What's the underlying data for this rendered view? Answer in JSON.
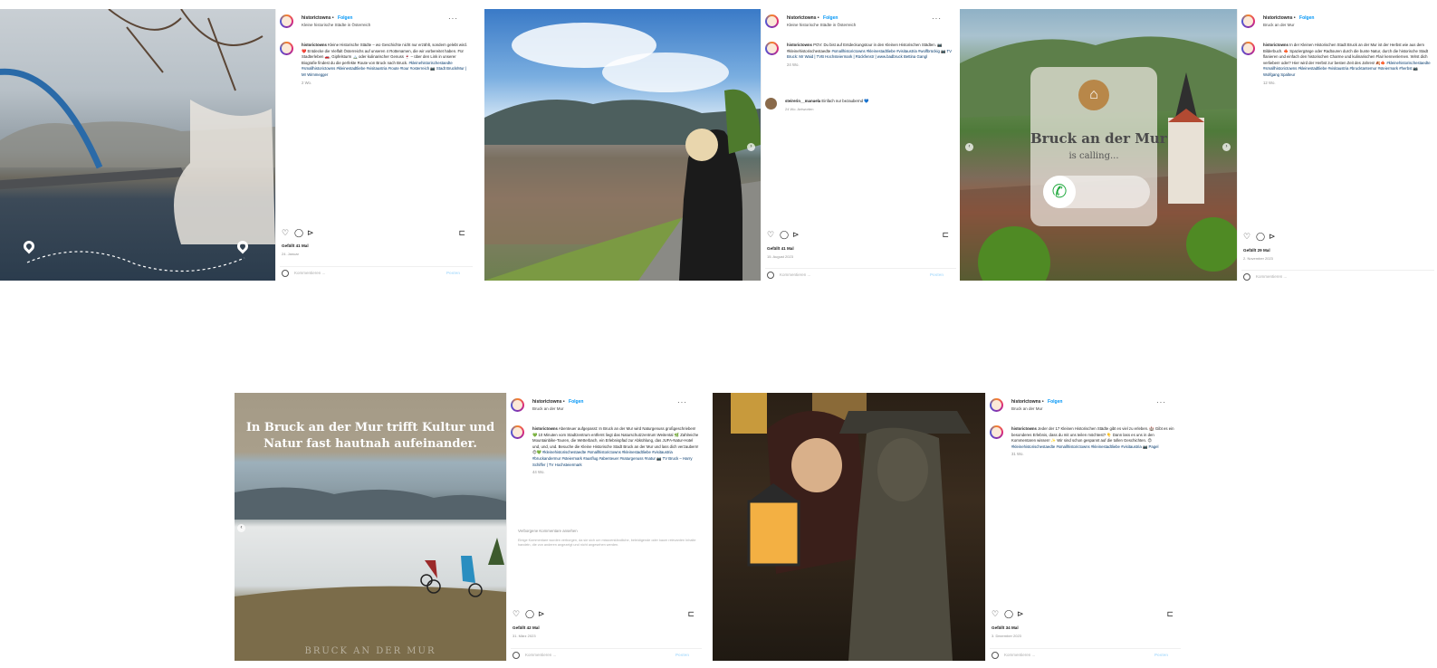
{
  "posts": [
    {
      "username": "historictowns",
      "follow_label": "Folgen",
      "subtitle": "Kleine historische Städte in Österreich",
      "more_label": "···",
      "caption_user": "historictowns",
      "caption": "Kleine Historische Städte – wo Geschichte nicht nur erzählt, sondern gelebt wird. ❤️ Entdecke die Vielfalt Österreichs auf unseren 4 Rottenamen, die wir vorbereitet haben. Für Stadterleben 🚗, Gipfelsturm 🏔️ oder kulinarischer Genuss 🍷 – über den Link in unserer Biografie findest du die perfekte Route von Bruck nach Bruck. ",
      "tags": "#kleinehistorischestaedte #smallhistorictowns #kleinestadtliebe #visitaustria #route #tour #osterreich 📷 Stadt Bruck/Mur | Mr Wimmegger",
      "time": "2 Wo.",
      "likes": "Gefällt 41 Mal",
      "date": "24. Januar",
      "comment_placeholder": "Kommentieren ...",
      "post_label": "Posten"
    },
    {
      "username": "historictowns",
      "follow_label": "Folgen",
      "subtitle": "Kleine historische Städte in Österreich",
      "more_label": "···",
      "caption_user": "historictowns",
      "caption": "POV: Du bist auf Entdeckungstour in den Kleinen Historischen Städten. 📷 #kleinehistorischestaedte ",
      "tags": "#smallhistorictowns #kleinestadtliebe #visitaustria #wolfbrückig 📷 TV Bruck: Mr Waid | TVB Hochsteiermark | Rückfenstr | www.badbruck Bettina Gangl",
      "time": "24 Wo.",
      "reply_user": "steirerin__manuela",
      "reply_text": "Einfach nur bezaubernd 💙",
      "reply_meta": "24 Wo.   Antworten",
      "likes": "Gefällt 41 Mal",
      "date": "15. August 2023",
      "comment_placeholder": "Kommentieren ...",
      "post_label": "Posten"
    },
    {
      "username": "historictowns",
      "follow_label": "Folgen",
      "subtitle": "Bruck an der Mur",
      "more_label": "···",
      "caption_user": "historictowns",
      "caption": "In der Kleinen Historischen Stadt Bruck an der Mur ist der Herbst wie aus dem Bilderbuch. 🍁 Spaziergänge oder Radtouren durch die bunte Natur, durch die historische Stadt flanieren und einfach den historischen Charme und kulinarischen Flair kennenlernen. Wirst dich verlieben! oder? Hier wird der Herbst zur besten Zeit des Jahres! 🍂🍁 ",
      "tags": "#kleinehistorischestaedte #smallhistorictowns #kleinestadtliebe #visitaustria #brucktantemur #steiermark #herbst 📷 Wolfgang Spalteur",
      "time": "12 Wo.",
      "overlay_title": "Bruck an der Mur",
      "overlay_sub": "is calling...",
      "likes": "Gefällt 29 Mal",
      "date": "2. November 2023",
      "comment_placeholder": "Kommentieren ...",
      "post_label": "Posten"
    },
    {
      "username": "historictowns",
      "follow_label": "Folgen",
      "subtitle": "Bruck an der Mur",
      "more_label": "···",
      "caption_user": "historictowns",
      "caption": "Abenteuer aufgepasst: In Bruck an der Mur wird Naturgenuss großgeschrieben! 💚 10 Minuten vom Stadtzentrum entfernt liegt das Naturschutzzentrum Weitental 🌿 Zahlreiche Mountainbike-Touren, die Wetterbach, ein Erlebnispfad zur Abkühlung, das JUFA-Natur-Hotel und, und, und. Besuche die Kleine Historische Stadt Bruck an der Mur und lass dich verzaubern! 😍💚 ",
      "tags": "#kleinehistorischestaedte #smallhistorictowns #kleinestadtliebe #visitaustria #bruckandermur #steiermark #ausflug #abenteuer #naturgenuss #natur 📷 TV Bruck – Harry Schiffer | TV Hochsteiermark",
      "time": "44 Wo.",
      "comments_link": "Verborgene Kommentare ansehen",
      "comments_note": "Einige Kommentare wurden verborgen, da sie sich um missverständliche, beleidigende oder kaum relevanten Inhalte handeln, die von anderen angezeigt und nicht angesehen werden.",
      "overlay_title": "In Bruck an der Mur trifft Kultur und Natur fast hautnah aufeinander.",
      "watermark": "BRUCK AN DER MUR",
      "likes": "Gefällt 42 Mal",
      "date": "31. März 2023",
      "comment_placeholder": "Kommentieren ...",
      "post_label": "Posten"
    },
    {
      "username": "historictowns",
      "follow_label": "Folgen",
      "subtitle": "Bruck an der Mur",
      "more_label": "···",
      "caption_user": "historictowns",
      "caption": "Jeder der 17 Kleinen Historischen Städte gibt es viel zu erleben. 🏰 Gibt es ein besonderes Erlebnis, dass du mit uns teilen möchtest? 👇 Dann lass es uns in den Kommentaren wissen! ✨ Wir sind schon gespannt auf die tollen Geschichten. 😍 ",
      "tags": "#kleinehistorischestaedte #smallhistorictowns #kleinestadtliebe #visitaustria 📷 Pagel",
      "time": "31 Wo.",
      "likes": "Gefällt 34 Mal",
      "date": "3. Dezember 2023",
      "comment_placeholder": "Kommentieren ...",
      "post_label": "Posten"
    }
  ],
  "icons": {
    "like": "♡",
    "comment": "◯",
    "share": "⊳",
    "save": "⊏",
    "next": "›",
    "prev": "‹",
    "phone": "✆",
    "home": "⌂"
  }
}
